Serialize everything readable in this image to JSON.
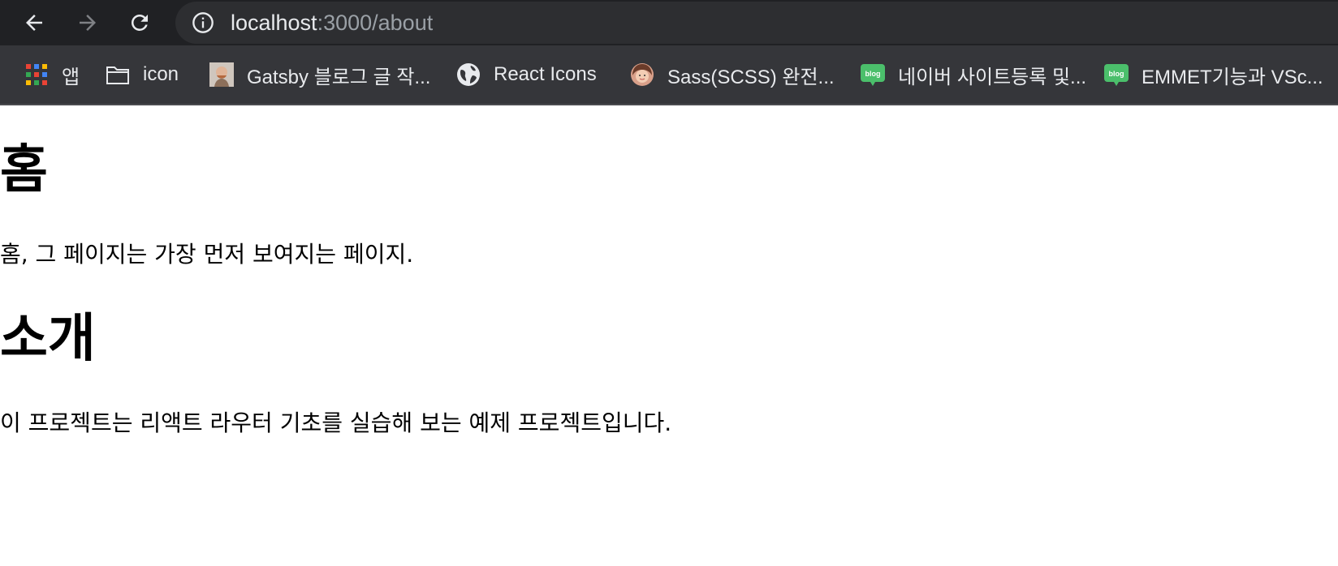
{
  "browser": {
    "url_host": "localhost",
    "url_path": ":3000/about"
  },
  "bookmarks": [
    {
      "label": "앱",
      "icon": "apps-grid-icon"
    },
    {
      "label": "icon",
      "icon": "folder-icon"
    },
    {
      "label": "Gatsby 블로그 글 작...",
      "icon": "avatar-favicon-icon"
    },
    {
      "label": "React Icons",
      "icon": "react-icons-globe-icon"
    },
    {
      "label": "Sass(SCSS) 완전...",
      "icon": "avatar-girl-favicon-icon"
    },
    {
      "label": "네이버 사이트등록 및...",
      "icon": "naver-blog-icon"
    },
    {
      "label": "EMMET기능과 VSc...",
      "icon": "naver-blog-icon"
    }
  ],
  "page": {
    "home_heading": "홈",
    "home_text": "홈, 그 페이지는 가장 먼저 보여지는 페이지.",
    "about_heading": "소개",
    "about_text": "이 프로젝트는 리액트 라우터 기초를 실습해 보는 예제 프로젝트입니다."
  },
  "colors": {
    "toolbar_bg": "#202124",
    "bookmarks_bg": "#35363a",
    "naver_green": "#4bbf6b"
  }
}
